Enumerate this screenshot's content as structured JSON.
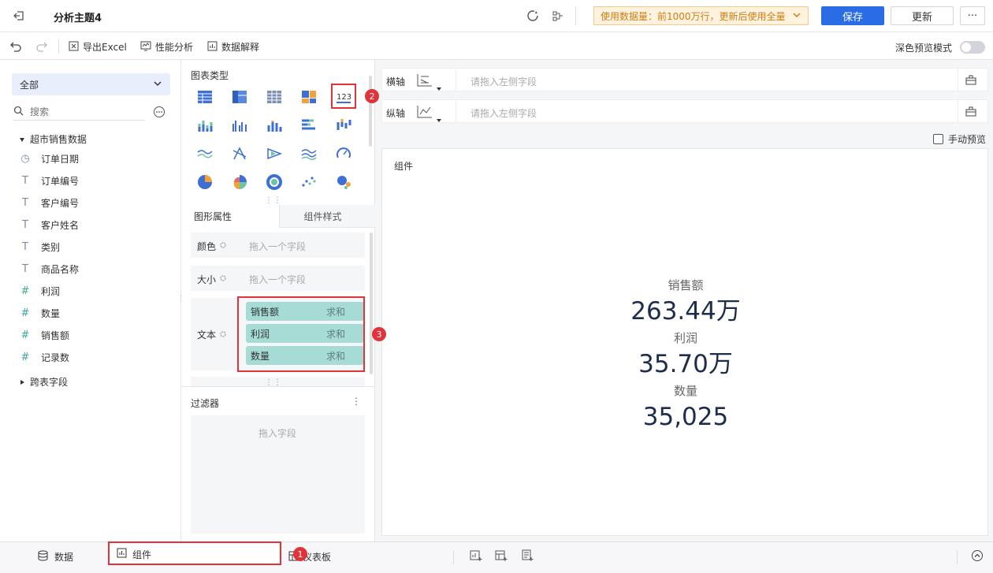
{
  "header": {
    "title": "分析主题4",
    "notice": "使用数据量：前1000万行，更新后使用全量",
    "save_label": "保存",
    "update_label": "更新",
    "more_label": "···"
  },
  "toolbar": {
    "export_label": "导出Excel",
    "perf_label": "性能分析",
    "explain_label": "数据解释",
    "dark_preview_label": "深色预览模式"
  },
  "sidebar": {
    "scope": "全部",
    "search_placeholder": "搜索",
    "dataset": "超市销售数据",
    "fields": [
      {
        "type": "date",
        "label": "订单日期"
      },
      {
        "type": "text",
        "label": "订单编号"
      },
      {
        "type": "text",
        "label": "客户编号"
      },
      {
        "type": "text",
        "label": "客户姓名"
      },
      {
        "type": "text",
        "label": "类别"
      },
      {
        "type": "text",
        "label": "商品名称"
      },
      {
        "type": "number",
        "label": "利润"
      },
      {
        "type": "number",
        "label": "数量"
      },
      {
        "type": "number",
        "label": "销售额"
      },
      {
        "type": "number",
        "label": "记录数"
      }
    ],
    "cross_table": "跨表字段"
  },
  "middle": {
    "chart_types_title": "图表类型",
    "tabs": [
      "图形属性",
      "组件样式"
    ],
    "props": {
      "color_label": "颜色",
      "color_placeholder": "拖入一个字段",
      "size_label": "大小",
      "size_placeholder": "拖入一个字段",
      "text_label": "文本"
    },
    "text_fields": [
      {
        "name": "销售额",
        "agg": "求和"
      },
      {
        "name": "利润",
        "agg": "求和"
      },
      {
        "name": "数量",
        "agg": "求和"
      }
    ],
    "filter_title": "过滤器",
    "filter_placeholder": "拖入字段"
  },
  "canvas": {
    "x_axis_label": "横轴",
    "y_axis_label": "纵轴",
    "axis_placeholder": "请拖入左侧字段",
    "manual_preview": "手动预览",
    "component_title": "组件",
    "kpis": [
      {
        "label": "销售额",
        "value": "263.44万"
      },
      {
        "label": "利润",
        "value": "35.70万"
      },
      {
        "label": "数量",
        "value": "35,025"
      }
    ]
  },
  "bottom": {
    "data_tab": "数据",
    "component_tab": "组件",
    "dashboard_tab": "仪表板"
  },
  "annotations": [
    "1",
    "2",
    "3"
  ],
  "colors": {
    "primary": "#2a6be6",
    "pill": "#a6dcd5",
    "highlight": "#e0343a",
    "notice_bg": "#fff3e0",
    "kpi_value": "#1f2d4d"
  }
}
